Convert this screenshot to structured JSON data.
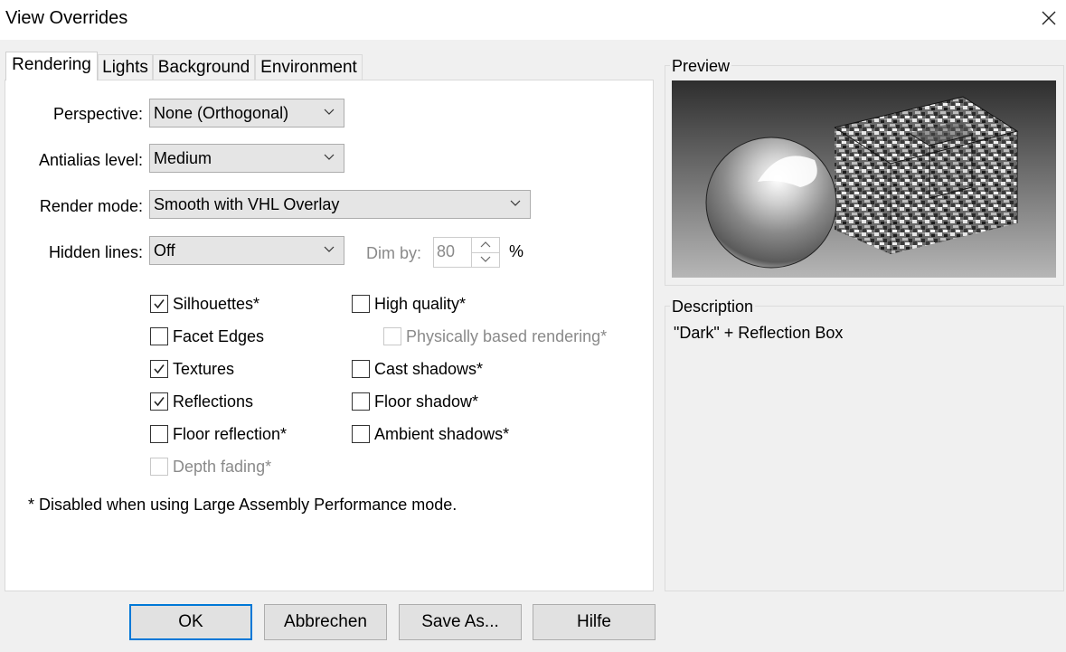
{
  "window": {
    "title": "View Overrides"
  },
  "tabs": [
    {
      "label": "Rendering",
      "active": true
    },
    {
      "label": "Lights"
    },
    {
      "label": "Background"
    },
    {
      "label": "Environment"
    }
  ],
  "rendering": {
    "perspective": {
      "label": "Perspective:",
      "value": "None (Orthogonal)"
    },
    "antialias": {
      "label": "Antialias level:",
      "value": "Medium"
    },
    "render_mode": {
      "label": "Render mode:",
      "value": "Smooth with VHL Overlay"
    },
    "hidden_lines": {
      "label": "Hidden lines:",
      "value": "Off"
    },
    "dim_by": {
      "label": "Dim by:",
      "value": "80",
      "unit": "%"
    },
    "options_left": [
      {
        "label": "Silhouettes*",
        "checked": true,
        "enabled": true
      },
      {
        "label": "Facet Edges",
        "checked": false,
        "enabled": true
      },
      {
        "label": "Textures",
        "checked": true,
        "enabled": true
      },
      {
        "label": "Reflections",
        "checked": true,
        "enabled": true
      },
      {
        "label": "Floor reflection*",
        "checked": false,
        "enabled": true
      },
      {
        "label": "Depth fading*",
        "checked": false,
        "enabled": false
      }
    ],
    "options_right": [
      {
        "label": "High quality*",
        "checked": false,
        "enabled": true
      },
      {
        "label": "Physically based rendering*",
        "checked": false,
        "enabled": false
      },
      {
        "label": "Cast shadows*",
        "checked": false,
        "enabled": true
      },
      {
        "label": "Floor shadow*",
        "checked": false,
        "enabled": true
      },
      {
        "label": "Ambient shadows*",
        "checked": false,
        "enabled": true
      }
    ],
    "footnote": "* Disabled when using Large Assembly Performance mode."
  },
  "preview": {
    "label": "Preview"
  },
  "description": {
    "label": "Description",
    "text": "\"Dark\" + Reflection Box"
  },
  "buttons": {
    "ok": "OK",
    "cancel": "Abbrechen",
    "save_as": "Save As...",
    "help": "Hilfe"
  },
  "icons": {
    "close": "close-icon",
    "dropdown": "chevron-down-icon",
    "check": "checkmark-icon"
  }
}
